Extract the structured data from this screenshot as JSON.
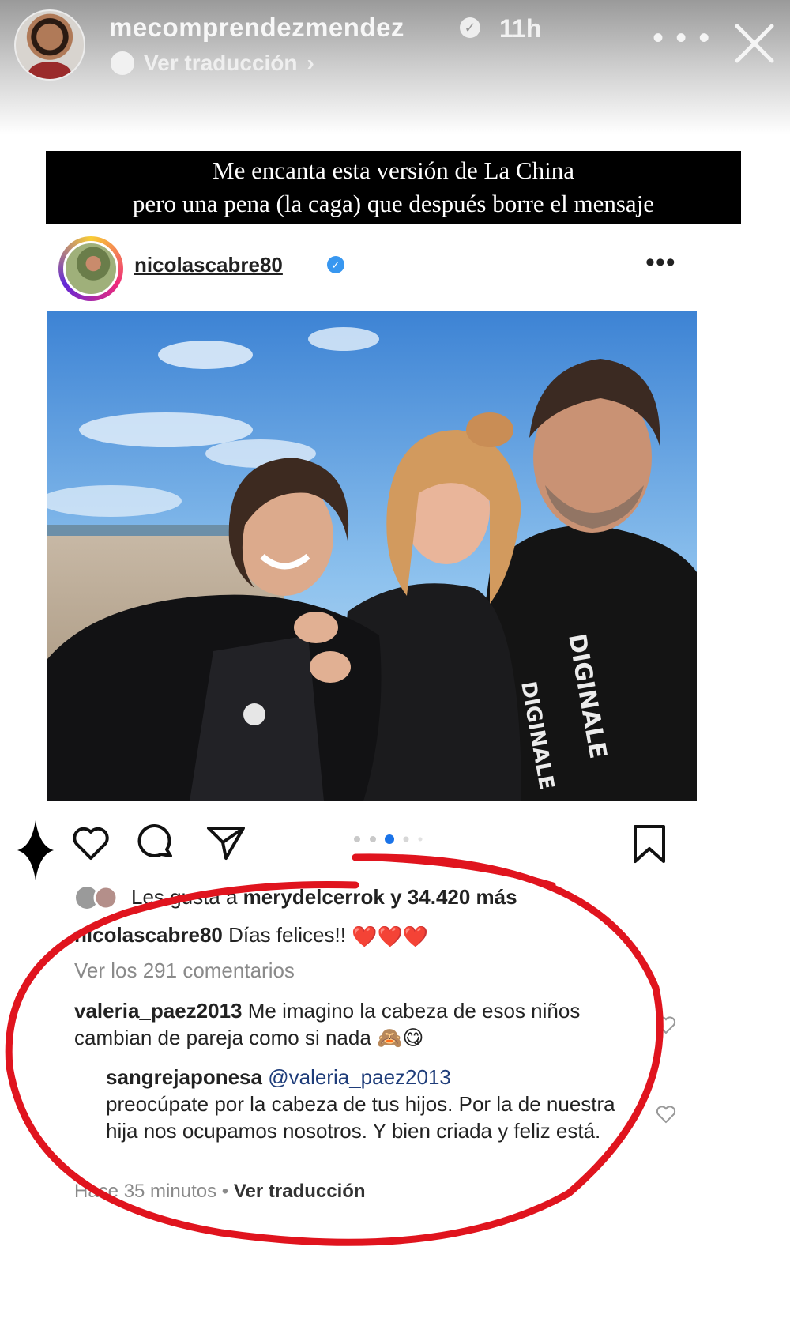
{
  "story": {
    "username": "mecomprendezmendez",
    "time": "11h",
    "translate_label": "Ver traducción",
    "caption_line1": "Me encanta esta versión de La China",
    "caption_line2": "pero una pena (la caga) que después borre el mensaje"
  },
  "post": {
    "username": "nicolascabre80",
    "likes_prefix": "Les gusta a ",
    "likes_user": "merydelcerrok",
    "likes_suffix": " y 34.420 más",
    "caption_user": "nicolascabre80",
    "caption_text": " Días felices!! ",
    "caption_hearts": "❤️❤️❤️",
    "view_comments": "Ver los 291 comentarios",
    "carousel": {
      "count": 5,
      "active_index": 2
    }
  },
  "comments": [
    {
      "user": "valeria_paez2013",
      "text": " Me imagino la cabeza de esos niños cambian de pareja como si nada 🙈😋"
    }
  ],
  "reply": {
    "user": "sangrejaponesa",
    "mention": "@valeria_paez2013",
    "text": "preocúpate por la cabeza de tus hijos. Por la de nuestra hija nos ocupamos nosotros. Y bien criada y feliz está."
  },
  "meta": {
    "time_ago": "Hace 35 minutos",
    "separator": " • ",
    "translate": "Ver traducción"
  },
  "colors": {
    "highlight": "#e0141e",
    "verified": "#3897f0"
  },
  "icons": [
    "close-icon",
    "more-icon",
    "heart-icon",
    "comment-icon",
    "share-icon",
    "bookmark-icon",
    "sparkle-icon"
  ]
}
